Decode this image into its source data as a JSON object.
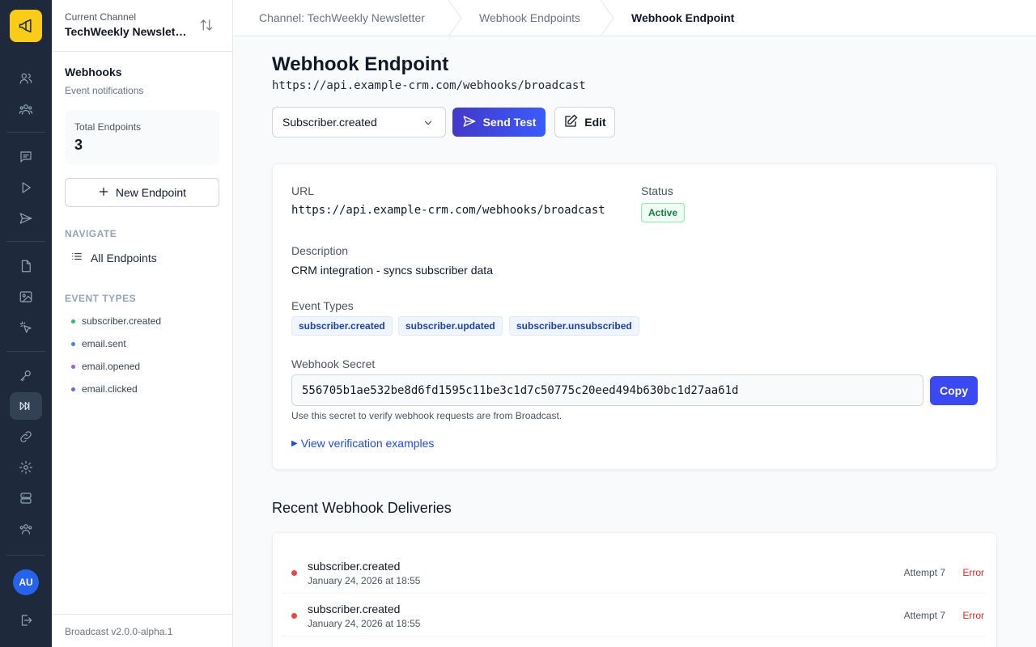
{
  "rail": {
    "avatar_initials": "AU",
    "icons": [
      "megaphone-icon",
      "users-icon",
      "team-icon",
      "chat-icon",
      "play-icon",
      "send-icon",
      "file-icon",
      "image-icon",
      "cursor-click-icon",
      "key-icon",
      "webhook-icon",
      "link-icon",
      "gear-icon",
      "server-icon",
      "group-icon",
      "logout-icon"
    ]
  },
  "sidebar": {
    "channel_label": "Current Channel",
    "channel_name": "TechWeekly Newsletter",
    "section_title": "Webhooks",
    "section_subtitle": "Event notifications",
    "total_label": "Total Endpoints",
    "total_value": "3",
    "new_button": "New Endpoint",
    "navigate_heading": "NAVIGATE",
    "nav_all": "All Endpoints",
    "event_types_heading": "EVENT TYPES",
    "event_types": [
      {
        "label": "subscriber.created",
        "color": "#22c55e"
      },
      {
        "label": "email.sent",
        "color": "#3b82f6"
      },
      {
        "label": "email.opened",
        "color": "#a855f7"
      },
      {
        "label": "email.clicked",
        "color": "#6366f1"
      }
    ],
    "version": "Broadcast v2.0.0-alpha.1"
  },
  "breadcrumb": {
    "items": [
      "Channel: TechWeekly Newsletter",
      "Webhook Endpoints",
      "Webhook Endpoint"
    ]
  },
  "header": {
    "title": "Webhook Endpoint",
    "url": "https://api.example-crm.com/webhooks/broadcast",
    "event_select_value": "Subscriber.created",
    "send_test": "Send Test",
    "edit": "Edit"
  },
  "details": {
    "url_label": "URL",
    "url_value": "https://api.example-crm.com/webhooks/broadcast",
    "status_label": "Status",
    "status_value": "Active",
    "description_label": "Description",
    "description_value": "CRM integration - syncs subscriber data",
    "event_types_label": "Event Types",
    "event_tags": [
      "subscriber.created",
      "subscriber.updated",
      "subscriber.unsubscribed"
    ],
    "secret_label": "Webhook Secret",
    "secret_value": "556705b1ae532be8d6fd1595c11be3c1d7c50775c20eed494b630bc1d27aa61d",
    "copy": "Copy",
    "secret_hint": "Use this secret to verify webhook requests are from Broadcast.",
    "verification_link": "View verification examples"
  },
  "deliveries": {
    "heading": "Recent Webhook Deliveries",
    "rows": [
      {
        "event": "subscriber.created",
        "date": "January 24, 2026 at 18:55",
        "attempt": "Attempt 7",
        "status": "Error"
      },
      {
        "event": "subscriber.created",
        "date": "January 24, 2026 at 18:55",
        "attempt": "Attempt 7",
        "status": "Error"
      }
    ]
  },
  "colors": {
    "rail_bg": "#1e293b",
    "brand_yellow": "#facc15",
    "accent": "#3b49f5",
    "active_green": "#15803d",
    "error_red": "#dc2626"
  }
}
